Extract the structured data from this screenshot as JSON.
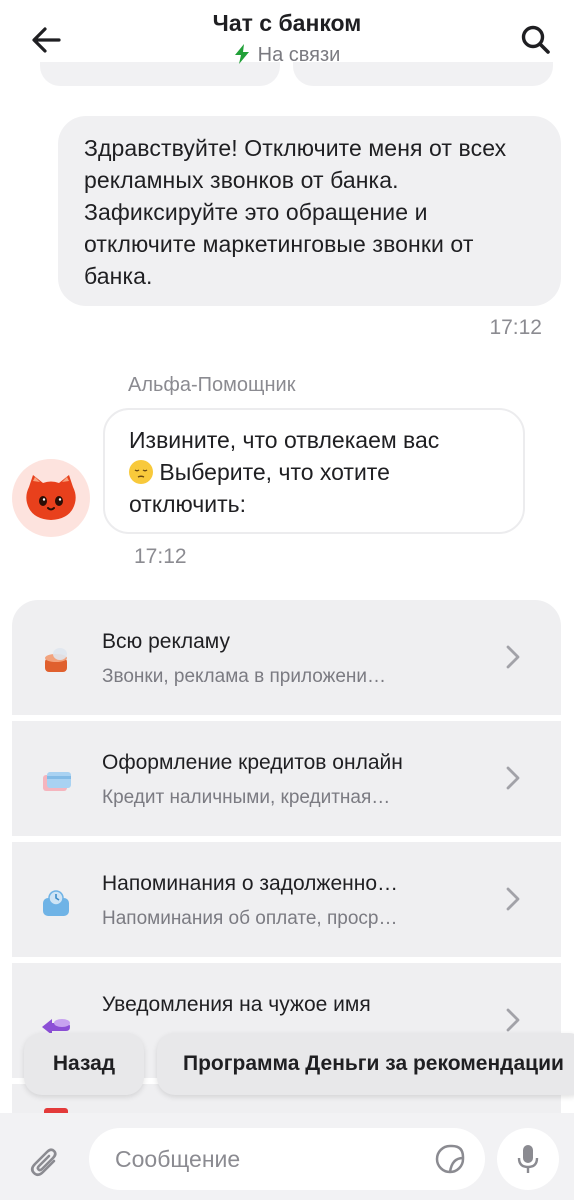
{
  "header": {
    "title": "Чат с банком",
    "status": "На связи",
    "back_icon": "arrow-left-icon",
    "search_icon": "search-icon",
    "status_icon": "lightning-icon",
    "status_color": "#21a038"
  },
  "messages": {
    "user": {
      "text": "Здравствуйте! Отключите меня от всех рекламных звонков от банка. Зафиксируйте это обращение и отключите маркетинговые звонки от банка.",
      "time": "17:12"
    },
    "bot": {
      "name": "Альфа-Помощник",
      "text_before_emoji": "Извините, что отвлекаем вас",
      "emoji": "pensive-face-icon",
      "text_after_emoji": "Выберите, что хотите отключить:",
      "time": "17:12"
    }
  },
  "options": [
    {
      "title": "Всю рекламу",
      "subtitle": "Звонки, реклама в приложени…",
      "icon": "megaphone-icon"
    },
    {
      "title": "Оформление кредитов онлайн",
      "subtitle": "Кредит наличными, кредитная…",
      "icon": "credit-card-icon"
    },
    {
      "title": "Напоминания о задолженно…",
      "subtitle": "Напоминания об оплате, проср…",
      "icon": "reminder-icon"
    },
    {
      "title": "Уведомления на чужое имя",
      "subtitle": "",
      "icon": "notification-icon"
    }
  ],
  "quick_replies": [
    "Назад",
    "Программа Деньги за рекомендации"
  ],
  "input": {
    "placeholder": "Сообщение",
    "attach_icon": "paperclip-icon",
    "sticker_icon": "sticker-icon",
    "mic_icon": "microphone-icon"
  }
}
